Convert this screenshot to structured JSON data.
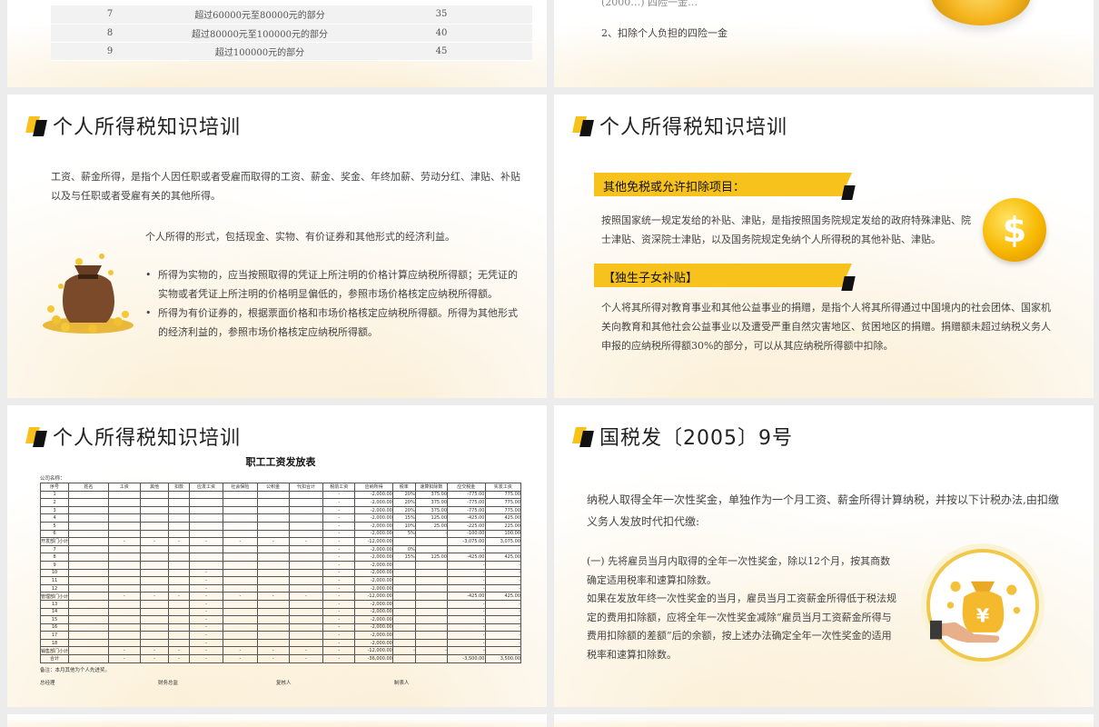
{
  "tax_table": {
    "rows": [
      {
        "no": "7",
        "range": "超过60000元至80000元的部分",
        "rate": "35"
      },
      {
        "no": "8",
        "range": "超过80000元至100000元的部分",
        "rate": "40"
      },
      {
        "no": "9",
        "range": "超过100000元的部分",
        "rate": "45"
      }
    ]
  },
  "top_right": {
    "partial_line": "(2000…) 四险一金…",
    "item2": "2、扣除个人负担的四险一金"
  },
  "slide_title": "个人所得税知识培训",
  "income_slide": {
    "para1": "工资、薪金所得，是指个人因任职或者受雇而取得的工资、薪金、奖金、年终加薪、劳动分红、津贴、补贴以及与任职或者受雇有关的其他所得。",
    "para2": "个人所得的形式，包括现金、实物、有价证券和其他形式的经济利益。",
    "bullets": [
      "所得为实物的，应当按照取得的凭证上所注明的价格计算应纳税所得额；无凭证的实物或者凭证上所注明的价格明显偏低的，参照市场价格核定应纳税所得额。",
      "所得为有价证券的，根据票面价格和市场价格核定应纳税所得额。所得为其他形式的经济利益的，参照市场价格核定应纳税所得额。"
    ]
  },
  "exempt_slide": {
    "banner1": "其他免税或允许扣除项目：",
    "para1": "按照国家统一规定发给的补贴、津贴，是指按照国务院规定发给的政府特殊津贴、院士津贴、资深院士津贴，以及国务院规定免纳个人所得税的其他补贴、津贴。",
    "banner2": "【独生子女补贴】",
    "para2": "个人将其所得对教育事业和其他公益事业的捐赠，是指个人将其所得通过中国境内的社会团体、国家机关向教育和其他社会公益事业以及遭受严重自然灾害地区、贫困地区的捐赠。捐赠额未超过纳税义务人申报的应纳税所得额30%的部分，可以从其应纳税所得额中扣除。",
    "coin_symbol": "$"
  },
  "salary_sheet": {
    "title": "职工工资发放表",
    "company_label": "公司名称：",
    "headers": [
      "序号",
      "姓名",
      "工资",
      "其他",
      "扣款",
      "应发工资",
      "社会保险",
      "公积金",
      "代扣合计",
      "税前工资",
      "应纳所得",
      "税率",
      "速算扣除数",
      "应交税金",
      "实发工资"
    ],
    "rows": [
      [
        "1",
        "",
        "",
        "",
        "",
        "",
        "",
        "",
        "",
        "-",
        "-2,000.00",
        "20%",
        "375.00",
        "-775.00",
        "775.00"
      ],
      [
        "2",
        "",
        "",
        "",
        "",
        "",
        "",
        "",
        "",
        "-",
        "-2,000.00",
        "20%",
        "375.00",
        "-775.00",
        "775.00"
      ],
      [
        "3",
        "",
        "",
        "",
        "",
        "",
        "",
        "",
        "",
        "-",
        "-2,000.00",
        "20%",
        "375.00",
        "-775.00",
        "775.00"
      ],
      [
        "4",
        "",
        "",
        "",
        "",
        "",
        "",
        "",
        "",
        "-",
        "-2,000.00",
        "15%",
        "125.00",
        "-425.00",
        "425.00"
      ],
      [
        "5",
        "",
        "",
        "",
        "",
        "",
        "",
        "",
        "",
        "-",
        "-2,000.00",
        "10%",
        "25.00",
        "-225.00",
        "225.00"
      ],
      [
        "6",
        "",
        "",
        "",
        "",
        "",
        "",
        "",
        "",
        "-",
        "-2,000.00",
        "5%",
        "-",
        "-100.00",
        "100.00"
      ],
      [
        "开发部门小计",
        "",
        "-",
        "-",
        "-",
        "-",
        "-",
        "-",
        "-",
        "-",
        "-12,000.00",
        "",
        "",
        "-3,075.00",
        "3,075.00"
      ],
      [
        "7",
        "",
        "",
        "",
        "",
        "",
        "",
        "",
        "",
        "-",
        "-2,000.00",
        "0%",
        "",
        "-",
        ""
      ],
      [
        "8",
        "",
        "",
        "",
        "",
        "",
        "",
        "",
        "",
        "-",
        "-2,000.00",
        "15%",
        "125.00",
        "-425.00",
        "425.00"
      ],
      [
        "9",
        "",
        "",
        "",
        "",
        "",
        "",
        "",
        "",
        "-",
        "-2,000.00",
        "",
        "",
        "-",
        "-"
      ],
      [
        "10",
        "",
        "",
        "",
        "",
        "-",
        "",
        "",
        "",
        "-",
        "-2,000.00",
        "",
        "",
        "-",
        "-"
      ],
      [
        "11",
        "",
        "",
        "",
        "",
        "-",
        "",
        "",
        "",
        "-",
        "-2,000.00",
        "",
        "",
        "-",
        "-"
      ],
      [
        "12",
        "",
        "",
        "",
        "",
        "-",
        "",
        "",
        "",
        "-",
        "-2,000.00",
        "",
        "",
        "-",
        "-"
      ],
      [
        "管理部门小计",
        "",
        "-",
        "-",
        "-",
        "-",
        "-",
        "-",
        "-",
        "-",
        "-12,000.00",
        "",
        "",
        "-425.00",
        "425.00"
      ],
      [
        "13",
        "",
        "",
        "",
        "",
        "-",
        "",
        "",
        "",
        "-",
        "-2,000.00",
        "",
        "",
        "-",
        "-"
      ],
      [
        "14",
        "",
        "",
        "",
        "",
        "-",
        "",
        "",
        "",
        "-",
        "-2,000.00",
        "",
        "",
        "-",
        "-"
      ],
      [
        "15",
        "",
        "",
        "",
        "",
        "-",
        "",
        "",
        "",
        "-",
        "-2,000.00",
        "",
        "",
        "-",
        "-"
      ],
      [
        "16",
        "",
        "",
        "",
        "",
        "-",
        "",
        "",
        "",
        "-",
        "-2,000.00",
        "",
        "",
        "-",
        "-"
      ],
      [
        "17",
        "",
        "",
        "",
        "",
        "-",
        "",
        "",
        "",
        "-",
        "-2,000.00",
        "",
        "",
        "-",
        "-"
      ],
      [
        "18",
        "",
        "",
        "",
        "",
        "-",
        "",
        "",
        "",
        "-",
        "-2,000.00",
        "",
        "",
        "-",
        "-"
      ],
      [
        "销售部门小计",
        "",
        "-",
        "-",
        "-",
        "-",
        "-",
        "-",
        "-",
        "-",
        "-12,000.00",
        "-",
        "-",
        "-",
        "-"
      ],
      [
        "合计",
        "",
        "-",
        "-",
        "-",
        "-",
        "-",
        "-",
        "-",
        "-",
        "-36,000.00",
        "",
        "",
        "-3,500.00",
        "3,500.00"
      ]
    ],
    "note": "备注：本月其他为个人先进奖。",
    "signatures": [
      "总经理",
      "财务总监",
      "复核人",
      "制表人"
    ]
  },
  "bonus_slide": {
    "title": "国税发〔2005〕9号",
    "para1": "纳税人取得全年一次性奖金，单独作为一个月工资、薪金所得计算纳税，并按以下计税办法,由扣缴义务人发放时代扣代缴:",
    "para2": "(一) 先将雇员当月内取得的全年一次性奖金，除以12个月，按其商数确定适用税率和速算扣除数。",
    "para3": "如果在发放年终一次性奖金的当月，雇员当月工资薪金所得低于税法规定的费用扣除额，应将全年一次性奖金减除“雇员当月工资薪金所得与费用扣除额的差额”后的余额，按上述办法确定全年一次性奖金的适用税率和速算扣除数。",
    "yen_symbol": "¥"
  },
  "colors": {
    "accent": "#f7c21b",
    "dark": "#111111"
  }
}
